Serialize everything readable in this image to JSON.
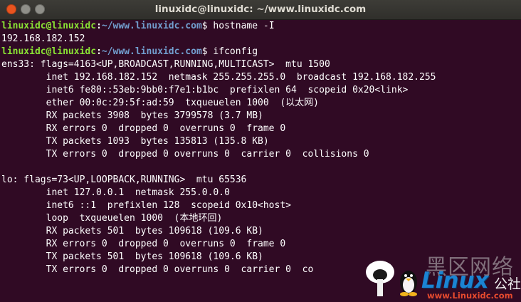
{
  "window": {
    "title": "linuxidc@linuxidc: ~/www.linuxidc.com",
    "buttons": [
      "close",
      "minimize",
      "maximize"
    ]
  },
  "prompt": {
    "user_host": "linuxidc@linuxidc",
    "colon": ":",
    "path": "~/www.linuxidc.com",
    "dollar": "$"
  },
  "terminal": {
    "cmd1": " hostname -I",
    "out1": "192.168.182.152",
    "cmd2": " ifconfig",
    "lines": [
      "ens33: flags=4163<UP,BROADCAST,RUNNING,MULTICAST>  mtu 1500",
      "        inet 192.168.182.152  netmask 255.255.255.0  broadcast 192.168.182.255",
      "        inet6 fe80::53eb:9bb0:f7e1:b1bc  prefixlen 64  scopeid 0x20<link>",
      "        ether 00:0c:29:5f:ad:59  txqueuelen 1000  (以太网)",
      "        RX packets 3908  bytes 3799578 (3.7 MB)",
      "        RX errors 0  dropped 0  overruns 0  frame 0",
      "        TX packets 1093  bytes 135813 (135.8 KB)",
      "        TX errors 0  dropped 0 overruns 0  carrier 0  collisions 0",
      "",
      "lo: flags=73<UP,LOOPBACK,RUNNING>  mtu 65536",
      "        inet 127.0.0.1  netmask 255.0.0.0",
      "        inet6 ::1  prefixlen 128  scopeid 0x10<host>",
      "        loop  txqueuelen 1000  (本地环回)",
      "        RX packets 501  bytes 109618 (109.6 KB)",
      "        RX errors 0  dropped 0  overruns 0  frame 0",
      "        TX packets 501  bytes 109618 (109.6 KB)",
      "        TX errors 0  dropped 0 overruns 0  carrier 0  co"
    ]
  },
  "watermark": {
    "cn": "黑区网络",
    "brand": "Linux",
    "suffix": "公社",
    "url": "www.Linuxidc.com"
  },
  "colors": {
    "background": "#300a24",
    "prompt_user": "#8ae234",
    "prompt_path": "#729fcf",
    "close_button": "#e9541f"
  }
}
